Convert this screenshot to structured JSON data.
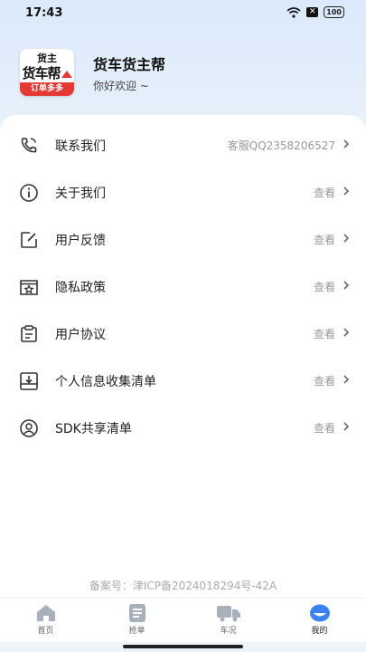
{
  "status_bar": {
    "time": "17:43",
    "battery": "100"
  },
  "header": {
    "logo_line1": "货主",
    "logo_line2": "货车帮",
    "logo_line3": "订单多多",
    "app_name": "货车货主帮",
    "greeting": "你好欢迎 ~"
  },
  "menu": [
    {
      "label": "联系我们",
      "value": "客服QQ2358206527",
      "icon": "phone-icon"
    },
    {
      "label": "关于我们",
      "value": "查看",
      "icon": "info-icon"
    },
    {
      "label": "用户反馈",
      "value": "查看",
      "icon": "edit-icon"
    },
    {
      "label": "隐私政策",
      "value": "查看",
      "icon": "privacy-icon"
    },
    {
      "label": "用户协议",
      "value": "查看",
      "icon": "clipboard-icon"
    },
    {
      "label": "个人信息收集清单",
      "value": "查看",
      "icon": "download-box-icon"
    },
    {
      "label": "SDK共享清单",
      "value": "查看",
      "icon": "user-circle-icon"
    }
  ],
  "footer": {
    "icp": "备案号：津ICP备2024018294号-42A"
  },
  "tabs": [
    {
      "label": "首页",
      "icon": "home-icon"
    },
    {
      "label": "抢单",
      "icon": "list-icon"
    },
    {
      "label": "车况",
      "icon": "truck-icon"
    },
    {
      "label": "我的",
      "icon": "profile-icon",
      "active": true
    }
  ],
  "colors": {
    "accent": "#3b82f6",
    "logo_red": "#e53935",
    "tab_gray": "#a8b0bb"
  }
}
